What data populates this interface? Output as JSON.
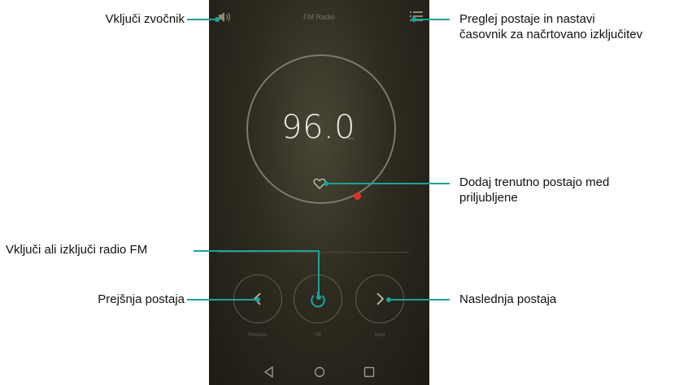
{
  "screen": {
    "title": "FM Radio",
    "frequency": "96.0",
    "frequency_unit": "MHz",
    "controls": {
      "previous_label": "Previous",
      "power_label": "Off",
      "next_label": "Next"
    }
  },
  "callouts": {
    "speaker": "Vključi zvočnik",
    "stations_line1": "Preglej postaje in nastavi",
    "stations_line2": "časovnik za načrtovano izključitev",
    "favorite_line1": "Dodaj trenutno postajo med",
    "favorite_line2": "priljubljene",
    "power": "Vključi ali izključi radio FM",
    "previous": "Prejšnja postaja",
    "next": "Naslednja postaja"
  },
  "colors": {
    "accent": "#1aa39a",
    "marker": "#d8352c",
    "background": "#2e2b20"
  },
  "icons": [
    "speaker-icon",
    "menu-icon",
    "heart-icon",
    "chevron-left-icon",
    "power-icon",
    "chevron-right-icon",
    "back-icon",
    "home-icon",
    "recents-icon"
  ]
}
